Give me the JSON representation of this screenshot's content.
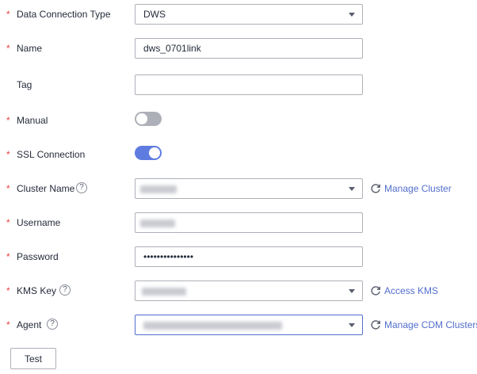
{
  "form": {
    "data_connection_type": {
      "label": "Data Connection Type",
      "value": "DWS"
    },
    "name": {
      "label": "Name",
      "value": "dws_0701link"
    },
    "tag": {
      "label": "Tag",
      "value": ""
    },
    "manual": {
      "label": "Manual",
      "enabled": false
    },
    "ssl_connection": {
      "label": "SSL Connection",
      "enabled": true
    },
    "cluster_name": {
      "label": "Cluster Name",
      "link": "Manage Cluster"
    },
    "username": {
      "label": "Username"
    },
    "password": {
      "label": "Password",
      "value": "•••••••••••••••"
    },
    "kms_key": {
      "label": "KMS Key",
      "link": "Access KMS"
    },
    "agent": {
      "label": "Agent",
      "link": "Manage CDM Clusters"
    }
  },
  "required_marker": "*",
  "help_glyph": "?",
  "buttons": {
    "test": "Test"
  },
  "colors": {
    "accent": "#526ecc",
    "toggle_on": "#5e7ce0",
    "toggle_off": "#adb0b8",
    "required": "#e8413e"
  },
  "icons": {
    "refresh": "refresh-icon",
    "dropdown": "chevron-down-icon",
    "help": "help-icon"
  }
}
